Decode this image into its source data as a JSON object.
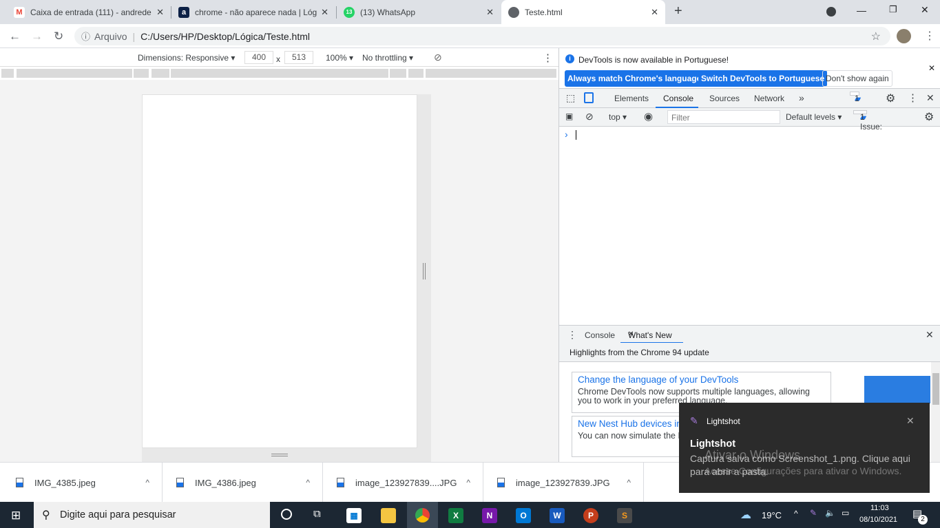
{
  "browser": {
    "tabs": [
      {
        "title": "Caixa de entrada (111) - andrede",
        "icon": "gmail-icon",
        "color": "#ea4335",
        "glyph": "M"
      },
      {
        "title": "chrome - não aparece nada | Lóg",
        "icon": "alura-icon",
        "color": "#0d2146",
        "glyph": "a"
      },
      {
        "title": "(13) WhatsApp",
        "icon": "whatsapp-icon",
        "color": "#25d366",
        "glyph": "13"
      },
      {
        "title": "Teste.html",
        "icon": "globe-icon",
        "color": "#5f6368",
        "glyph": "◐"
      }
    ],
    "new_tab": "+",
    "address_prefix": "Arquivo",
    "url": "C:/Users/HP/Desktop/Lógica/Teste.html"
  },
  "device_toolbar": {
    "dimensions": "Dimensions: Responsive ▾",
    "width": "400",
    "x": "x",
    "height": "513",
    "zoom": "100% ▾",
    "throttling": "No throttling ▾"
  },
  "devtools": {
    "info": "DevTools is now available in Portuguese!",
    "btn_match": "Always match Chrome's language",
    "btn_switch": "Switch DevTools to Portuguese",
    "btn_dont": "Don't show again",
    "tabs": [
      "Elements",
      "Console",
      "Sources",
      "Network"
    ],
    "active_tab": "Console",
    "more": "»",
    "issues_badge": "1",
    "context": "top ▾",
    "filter_placeholder": "Filter",
    "levels": "Default levels ▾",
    "issues": "1 Issue:",
    "issues_count": "1",
    "prompt": "›",
    "drawer_tabs": [
      "Console",
      "What's New"
    ],
    "highlights": "Highlights from the Chrome 94 update",
    "cards": [
      {
        "title": "Change the language of your DevTools",
        "body": "Chrome DevTools now supports multiple languages, allowing you to work in your preferred language."
      },
      {
        "title": "New Nest Hub devices in the Device list",
        "body": "You can now simulate the Nest Hub devices in DevTools."
      }
    ]
  },
  "downloads": [
    "IMG_4385.jpeg",
    "IMG_4386.jpeg",
    "image_123927839....JPG",
    "image_123927839.JPG"
  ],
  "toast": {
    "app": "Lightshot",
    "title": "Lightshot",
    "body": "Captura salva como Screenshot_1.png. Clique aqui para abrir a pasta.",
    "watermark1": "Ativar o Windows",
    "watermark2": "Acesse Configurações para ativar o Windows."
  },
  "taskbar": {
    "search_placeholder": "Digite aqui para pesquisar",
    "weather": "19°C",
    "time": "11:03",
    "date": "08/10/2021",
    "notifications": "2"
  }
}
